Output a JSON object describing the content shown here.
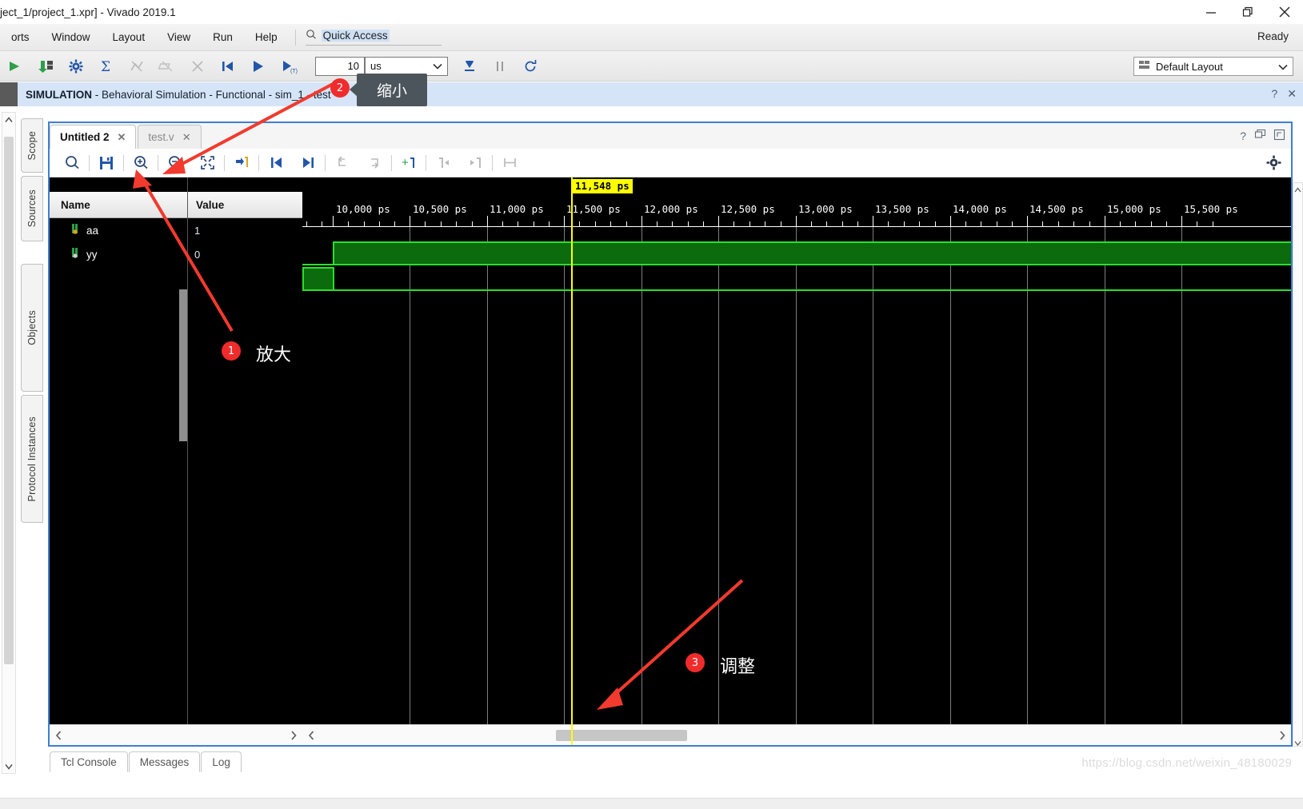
{
  "window": {
    "title": "ject_1/project_1.xpr] - Vivado 2019.1",
    "minimize_label": "—",
    "restore_label": "❐",
    "close_label": "✕"
  },
  "menubar": {
    "items": [
      {
        "label": "orts",
        "name": "menu-reports"
      },
      {
        "label": "Window",
        "name": "menu-window"
      },
      {
        "label": "Layout",
        "name": "menu-layout"
      },
      {
        "label": "View",
        "name": "menu-view"
      },
      {
        "label": "Run",
        "name": "menu-run"
      },
      {
        "label": "Help",
        "name": "menu-help"
      }
    ],
    "quick_access_placeholder": "Quick Access",
    "quick_access_value": "Quick Access",
    "status": "Ready"
  },
  "toolbar": {
    "time_value": "10",
    "time_unit": "us",
    "layout_label": "Default Layout",
    "icons": [
      "run-all-icon",
      "step-binary-icon",
      "settings-gear-icon",
      "sigma-icon",
      "break-icon",
      "relaunch-icon",
      "restart-icon",
      "restart-sim-icon",
      "run-icon",
      "run-for-time-icon"
    ]
  },
  "simulation_banner": {
    "label": "SIMULATION",
    "detail": " - Behavioral Simulation - Functional - sim_1 - test",
    "help_icon": "?",
    "close_icon": "✕"
  },
  "vertical_tabs": [
    {
      "label": "Scope",
      "name": "vtab-scope"
    },
    {
      "label": "Sources",
      "name": "vtab-sources"
    },
    {
      "label": "Objects",
      "name": "vtab-objects"
    },
    {
      "label": "Protocol Instances",
      "name": "vtab-protocol-instances"
    }
  ],
  "panel": {
    "tabs": [
      {
        "label": "Untitled 2",
        "active": true,
        "close": "✕"
      },
      {
        "label": "test.v",
        "active": false,
        "close": "✕"
      }
    ],
    "header_icons": [
      "help-icon",
      "float-icon",
      "maximize-icon"
    ],
    "toolbar_icons": [
      "search-icon",
      "save-waveform-icon",
      "zoom-in-icon",
      "zoom-out-icon",
      "zoom-fit-icon",
      "zoom-to-cursor-icon",
      "go-to-start-icon",
      "go-to-end-icon",
      "previous-transition-icon",
      "next-transition-icon",
      "add-marker-icon",
      "previous-marker-icon",
      "next-marker-icon",
      "swap-cursor-icon"
    ],
    "settings_icon": "gear-icon"
  },
  "signal_table": {
    "columns": [
      "Name",
      "Value"
    ],
    "rows": [
      {
        "name": "aa",
        "value": "1",
        "icon": "signal-input-icon"
      },
      {
        "name": "yy",
        "value": "0",
        "icon": "signal-output-icon"
      }
    ]
  },
  "waveform": {
    "cursor_label": "11,548 ps",
    "cursor_time_ps": 11548,
    "tick_labels": [
      "10,000 ps",
      "10,500 ps",
      "11,000 ps",
      "11,500 ps",
      "12,000 ps",
      "12,500 ps",
      "13,000 ps",
      "13,500 ps",
      "14,000 ps",
      "14,500 ps",
      "15,000 ps",
      "15,500 ps"
    ],
    "tick_values_ps": [
      10000,
      10500,
      11000,
      11500,
      12000,
      12500,
      13000,
      13500,
      14000,
      14500,
      15000,
      15500
    ],
    "signals": [
      {
        "name": "aa",
        "transitions_ps": [
          [
            9760,
            "0"
          ],
          [
            10000,
            "1"
          ]
        ]
      },
      {
        "name": "yy",
        "transitions_ps": [
          [
            9760,
            "1"
          ],
          [
            10000,
            "0"
          ]
        ]
      }
    ],
    "wave_color": "#29e02b",
    "wave_fill": "#0b6b0d",
    "cursor_color": "#ffff00",
    "background": "#000000"
  },
  "annotations": [
    {
      "number": "1",
      "text": "放大",
      "name": "annotation-zoom-in"
    },
    {
      "number": "2",
      "text": "缩小",
      "name": "annotation-zoom-out"
    },
    {
      "number": "3",
      "text": "调整",
      "name": "annotation-adjust"
    }
  ],
  "tooltip": {
    "text": "缩小"
  },
  "bottom_tabs": [
    {
      "label": "Tcl Console",
      "name": "bottom-tab-tcl-console"
    },
    {
      "label": "Messages",
      "name": "bottom-tab-messages"
    },
    {
      "label": "Log",
      "name": "bottom-tab-log"
    }
  ],
  "watermark": "https://blog.csdn.net/weixin_48180029"
}
